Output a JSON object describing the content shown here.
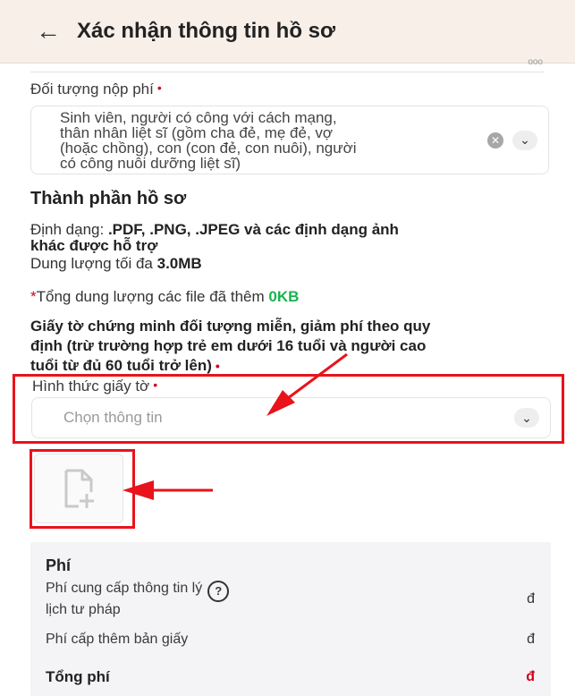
{
  "header": {
    "back_icon": "arrow-left-icon",
    "title": "Xác nhận thông tin hồ sơ"
  },
  "payer": {
    "label": "Đối tượng nộp phí",
    "required_mark": "•",
    "value_lines": [
      "Sinh viên, người có công với cách mạng,",
      "thân nhân liệt sĩ (gồm cha đẻ, mẹ đẻ, vợ",
      "(hoặc chồng), con (con đẻ, con nuôi), người",
      "có công nuôi dưỡng liệt sĩ)"
    ],
    "clear_icon": "clear-icon",
    "dropdown_icon": "chevron-down-icon"
  },
  "documents": {
    "section_title": "Thành phần hồ sơ",
    "format_prefix": "Định dạng: ",
    "format_bold_1": ".PDF, .PNG, .JPEG và các định dạng ảnh",
    "format_bold_2": "khác được hỗ trợ",
    "max_size_prefix": "Dung lượng tối đa ",
    "max_size_value": "3.0MB",
    "total_star": "*",
    "total_label": "Tổng dung lượng các file đã thêm ",
    "total_value": "0KB",
    "proof_lines": [
      "Giấy tờ chứng minh đối tượng miễn, giảm phí theo quy",
      "định (trừ trường hợp trẻ em dưới 16 tuổi và người cao",
      "tuổi từ đủ 60 tuổi trở lên)"
    ],
    "doc_type_label": "Hình thức giấy tờ",
    "doc_type_placeholder": "Chọn thông tin",
    "upload_icon": "add-file-icon"
  },
  "fees": {
    "title": "Phí",
    "rows": [
      {
        "label_1": "Phí cung cấp thông tin lý",
        "label_2": "lịch tư pháp",
        "currency": "đ",
        "help_icon": "help-icon"
      },
      {
        "label_1": "Phí cấp thêm bản giấy",
        "currency": "đ"
      }
    ],
    "total_label": "Tổng phí",
    "total_currency": "đ"
  },
  "colors": {
    "required": "#d0021b",
    "accent_green": "#18b350",
    "annotation_red": "#e8131b",
    "header_bg": "#f7efe8"
  }
}
